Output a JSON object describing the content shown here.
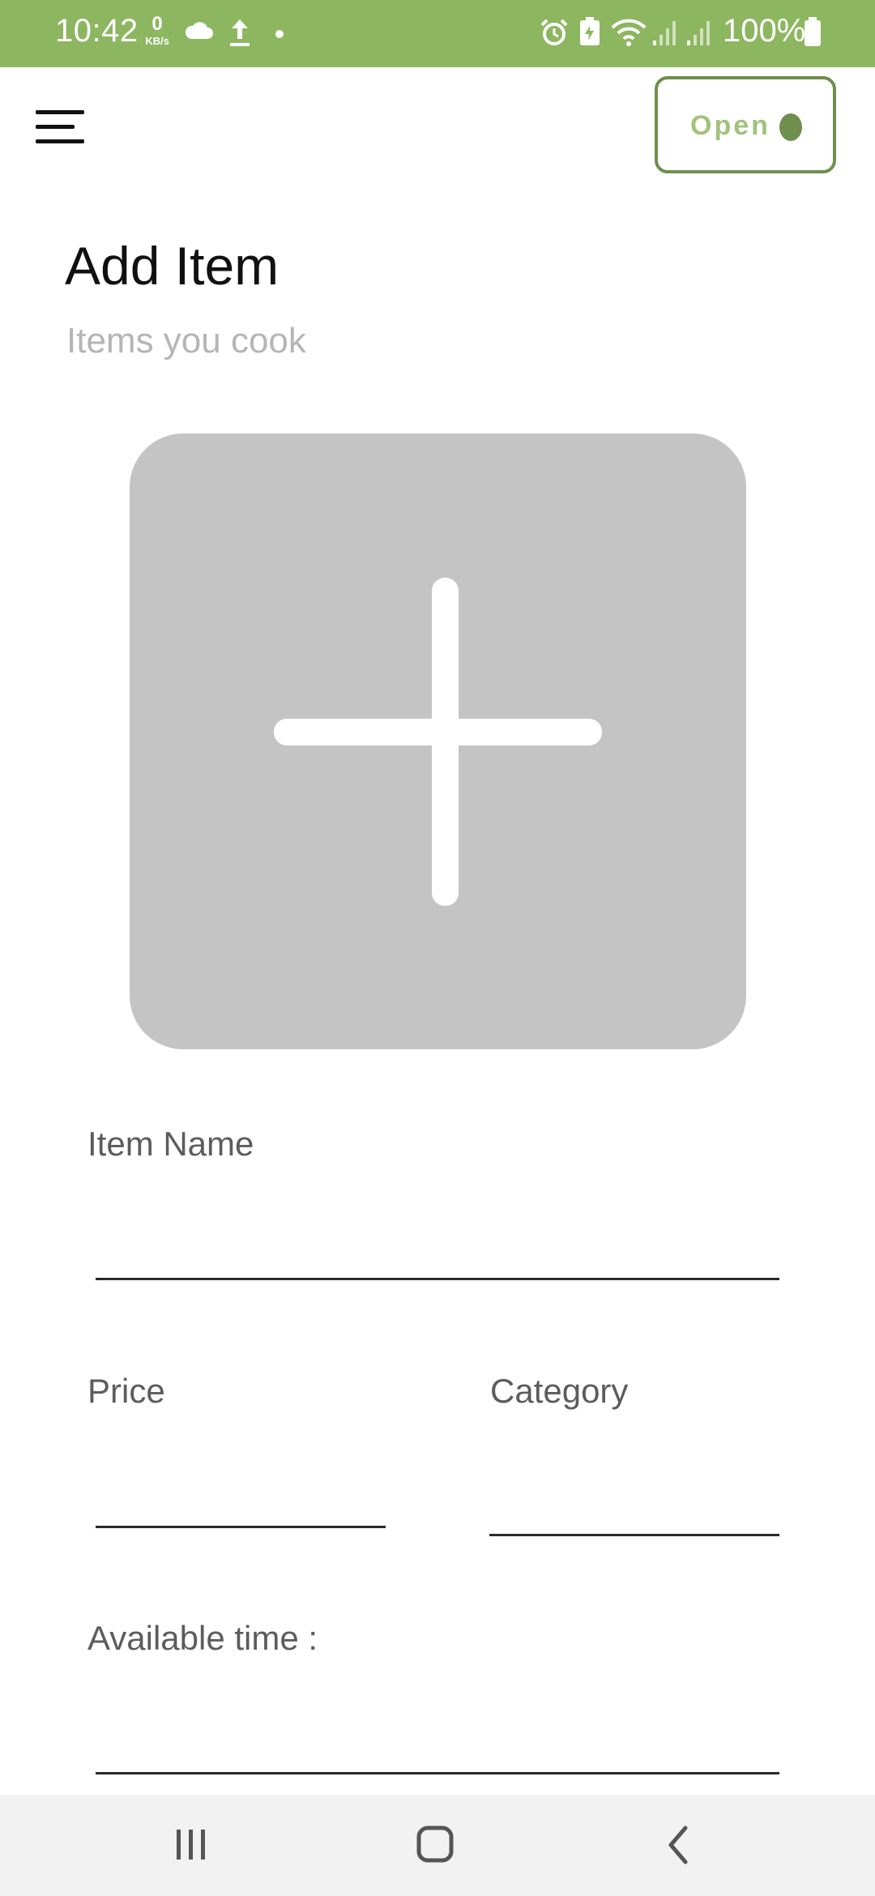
{
  "status_bar": {
    "time": "10:42",
    "net_speed_value": "0",
    "net_speed_unit": "KB/s",
    "battery": "100%",
    "background": "#8db660"
  },
  "header": {
    "menu_icon": "hamburger-menu-icon",
    "open_label": "Open",
    "open_color": "#a2c27c",
    "open_border_color": "#6f8f4e"
  },
  "page": {
    "title": "Add Item",
    "subtitle": "Items you cook"
  },
  "image_picker": {
    "icon": "plus-icon",
    "background": "#c4c4c4"
  },
  "form": {
    "item_name_label": "Item Name",
    "item_name_value": "",
    "price_label": "Price",
    "price_value": "",
    "category_label": "Category",
    "category_value": "",
    "available_time_label": "Available time :",
    "available_time_value": ""
  },
  "nav_bar": {
    "recents_icon": "recents-icon",
    "home_icon": "home-icon",
    "back_icon": "back-icon"
  }
}
